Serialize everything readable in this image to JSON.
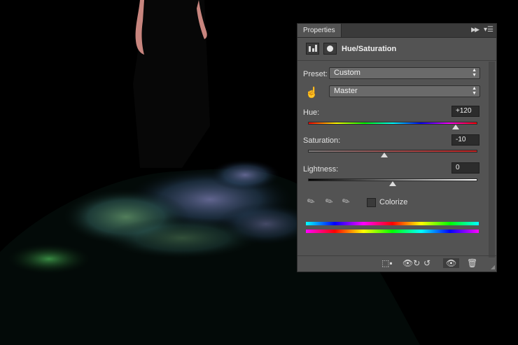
{
  "panel": {
    "tab": "Properties",
    "title": "Hue/Saturation",
    "preset_label": "Preset:",
    "preset_value": "Custom",
    "channel_value": "Master",
    "hue": {
      "label": "Hue:",
      "value": "+120",
      "level": 0.87
    },
    "saturation": {
      "label": "Saturation:",
      "value": "-10",
      "level": 0.45
    },
    "lightness": {
      "label": "Lightness:",
      "value": "0",
      "level": 0.5
    },
    "colorize_label": "Colorize"
  },
  "icons": {
    "collapse": "double-chevron-right-icon",
    "menu": "panel-menu-icon",
    "adjustment": "levels-icon",
    "mask": "mask-icon",
    "on_image": "targeted-adjustment-hand-icon",
    "eyedropper": "eyedropper-icon",
    "eyedropper_add": "eyedropper-plus-icon",
    "eyedropper_subtract": "eyedropper-minus-icon",
    "clip": "clip-to-layer-icon",
    "view_previous": "view-previous-icon",
    "reset": "reset-icon",
    "visibility": "eye-icon",
    "delete": "trash-icon"
  }
}
